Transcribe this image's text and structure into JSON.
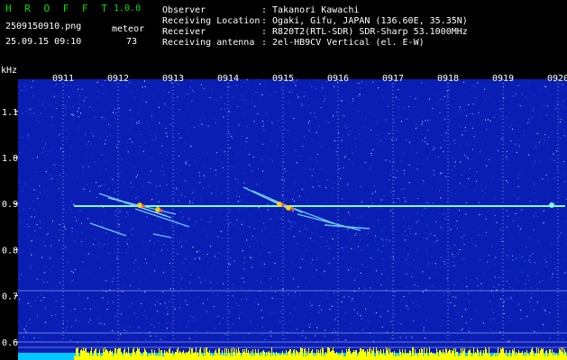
{
  "app": {
    "name": "H R O F F T",
    "version": "1.0.0"
  },
  "file": {
    "name": "2509150910.png",
    "datetime": "25.09.15 09:10"
  },
  "meteor": {
    "label": "meteor",
    "count": "73"
  },
  "info": [
    {
      "key": "Observer",
      "value": ": Takanori Kawachi"
    },
    {
      "key": "Receiving Location",
      "value": ": Ogaki, Gifu, JAPAN (136.60E, 35.35N)"
    },
    {
      "key": "Receiver",
      "value": ": R820T2(RTL-SDR) SDR-Sharp 53.1000MHz"
    },
    {
      "key": "Receiving antenna",
      "value": ": 2el-HB9CV Vertical (el. E-W)"
    }
  ],
  "chart_data": {
    "type": "heatmap",
    "ylabel": "kHz",
    "x_ticks": [
      "0911",
      "0912",
      "0913",
      "0914",
      "0915",
      "0916",
      "0917",
      "0918",
      "0919",
      "0920"
    ],
    "y_ticks": [
      "1.1",
      "1.0",
      "0.9",
      "0.8",
      "0.7",
      "0.6"
    ],
    "ylim": [
      0.58,
      1.17
    ],
    "colors": {
      "background": "#0a1eb4",
      "carrier": "#7fffd4",
      "echo": "#ffdd00",
      "grid": "#ffffff",
      "bars": "#ffff00",
      "bars_base": "#00c8ff"
    }
  }
}
